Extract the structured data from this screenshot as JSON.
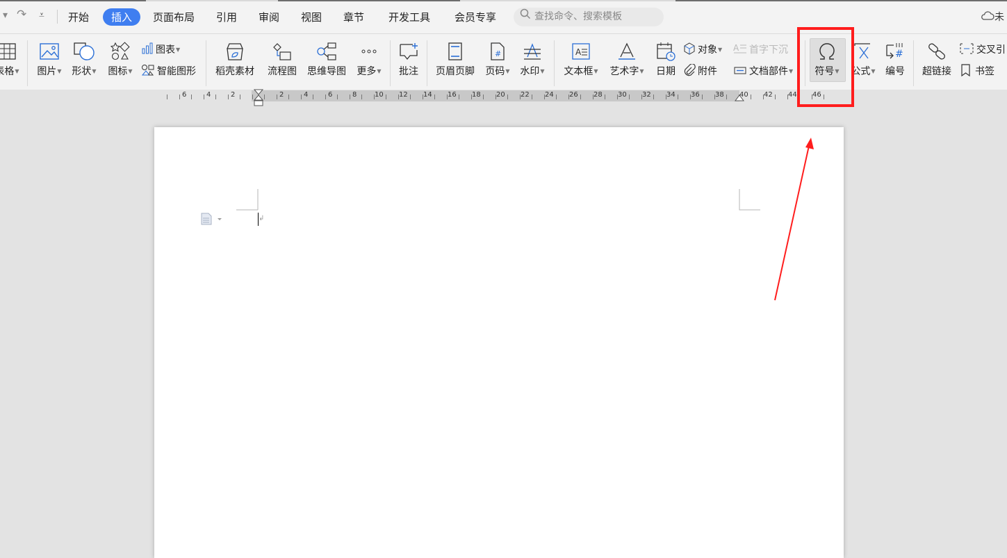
{
  "menu_tabs": [
    {
      "label": "开始"
    },
    {
      "label": "插入"
    },
    {
      "label": "页面布局"
    },
    {
      "label": "引用"
    },
    {
      "label": "审阅"
    },
    {
      "label": "视图"
    },
    {
      "label": "章节"
    },
    {
      "label": "开发工具"
    },
    {
      "label": "会员专享"
    }
  ],
  "search": {
    "placeholder": "查找命令、搜索模板"
  },
  "cloud_label": "未",
  "ribbon": {
    "table": "表格",
    "picture": "图片",
    "shape": "形状",
    "icon": "图标",
    "chart": "图表",
    "smart_graphic": "智能图形",
    "daoke": "稻壳素材",
    "flowchart": "流程图",
    "mindmap": "思维导图",
    "more": "更多",
    "comment": "批注",
    "header_footer": "页眉页脚",
    "page_number": "页码",
    "watermark": "水印",
    "textbox": "文本框",
    "wordart": "艺术字",
    "date": "日期",
    "object": "对象",
    "attachment": "附件",
    "dropcap": "首字下沉",
    "doc_parts": "文档部件",
    "symbol": "符号",
    "formula": "公式",
    "numbering": "编号",
    "hyperlink": "超链接",
    "crossref": "交叉引",
    "bookmark": "书签"
  },
  "ruler_labels": [
    {
      "t": "6"
    },
    {
      "t": "4"
    },
    {
      "t": "2"
    },
    {
      "t": "2"
    },
    {
      "t": "4"
    },
    {
      "t": "6"
    },
    {
      "t": "8"
    },
    {
      "t": "10"
    },
    {
      "t": "12"
    },
    {
      "t": "14"
    },
    {
      "t": "16"
    },
    {
      "t": "18"
    },
    {
      "t": "20"
    },
    {
      "t": "22"
    },
    {
      "t": "24"
    },
    {
      "t": "26"
    },
    {
      "t": "28"
    },
    {
      "t": "30"
    },
    {
      "t": "32"
    },
    {
      "t": "34"
    },
    {
      "t": "36"
    },
    {
      "t": "38"
    },
    {
      "t": "40"
    },
    {
      "t": "42"
    },
    {
      "t": "44"
    },
    {
      "t": "46"
    }
  ],
  "colors": {
    "accent": "#3f7ef0",
    "highlight": "#ff1d1d"
  }
}
